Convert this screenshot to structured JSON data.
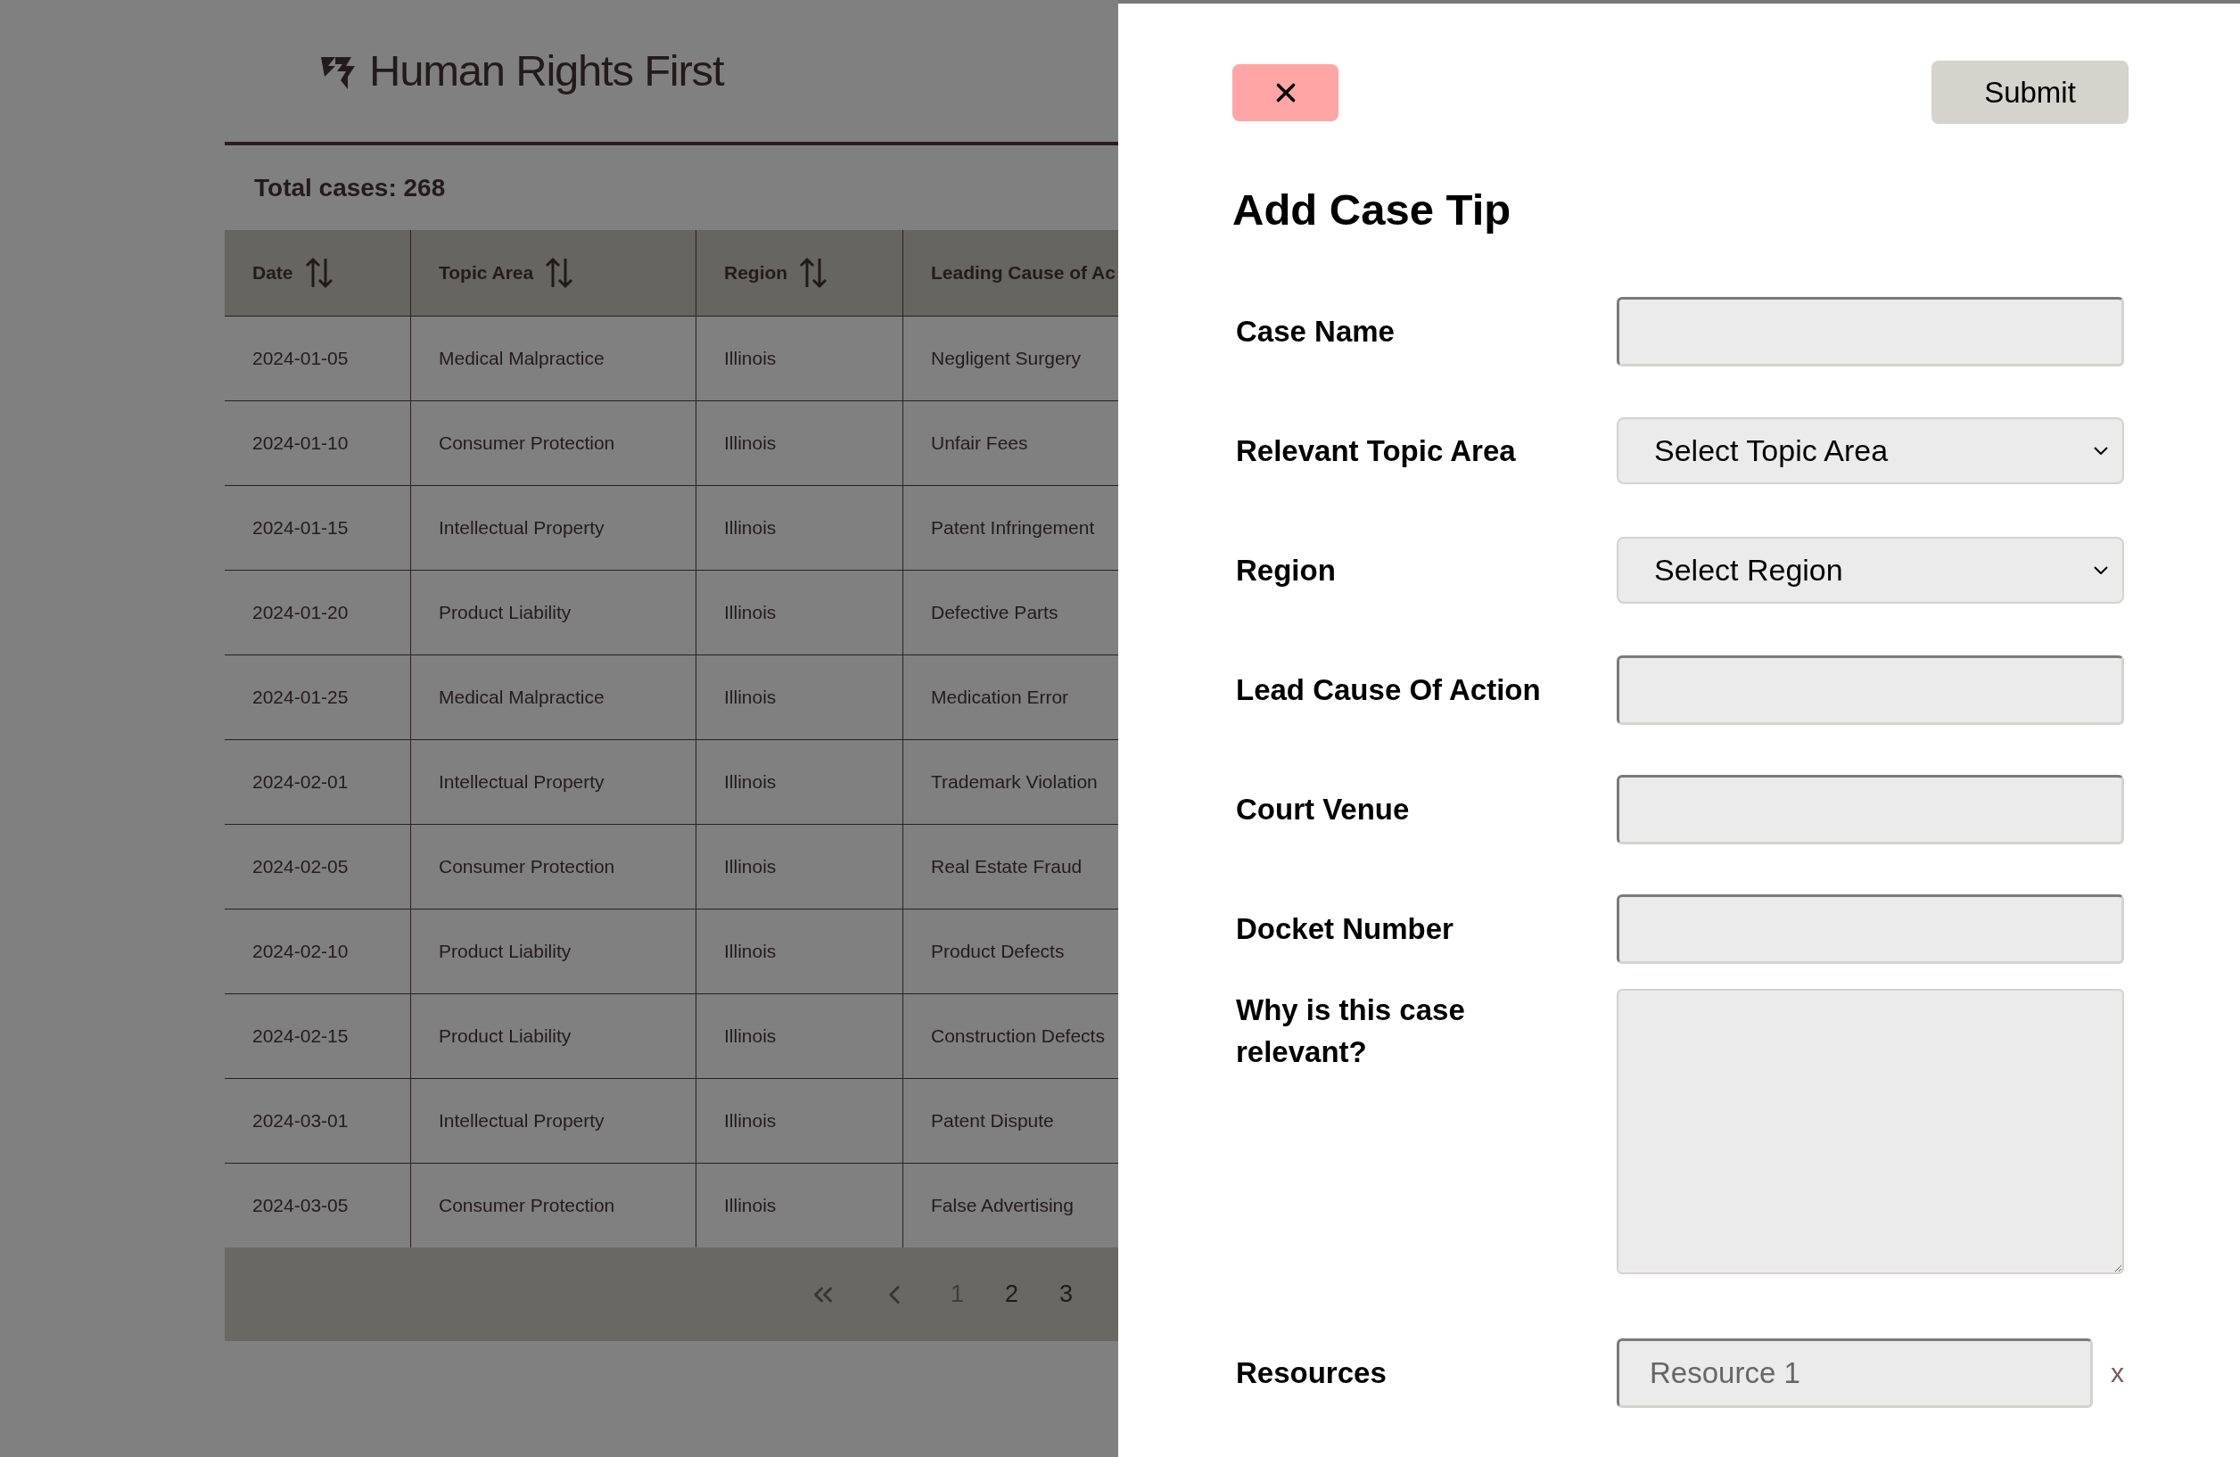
{
  "brand": {
    "name": "Human Rights First"
  },
  "total_cases": "Total cases: 268",
  "table": {
    "columns": [
      {
        "label": "Date",
        "sortable": true
      },
      {
        "label": "Topic Area",
        "sortable": true
      },
      {
        "label": "Region",
        "sortable": true
      },
      {
        "label": "Leading Cause of Ac"
      }
    ],
    "rows": [
      [
        "2024-01-05",
        "Medical Malpractice",
        "Illinois",
        "Negligent Surgery"
      ],
      [
        "2024-01-10",
        "Consumer Protection",
        "Illinois",
        "Unfair Fees"
      ],
      [
        "2024-01-15",
        "Intellectual Property",
        "Illinois",
        "Patent Infringement"
      ],
      [
        "2024-01-20",
        "Product Liability",
        "Illinois",
        "Defective Parts"
      ],
      [
        "2024-01-25",
        "Medical Malpractice",
        "Illinois",
        "Medication Error"
      ],
      [
        "2024-02-01",
        "Intellectual Property",
        "Illinois",
        "Trademark Violation"
      ],
      [
        "2024-02-05",
        "Consumer Protection",
        "Illinois",
        "Real Estate Fraud"
      ],
      [
        "2024-02-10",
        "Product Liability",
        "Illinois",
        "Product Defects"
      ],
      [
        "2024-02-15",
        "Product Liability",
        "Illinois",
        "Construction Defects"
      ],
      [
        "2024-03-01",
        "Intellectual Property",
        "Illinois",
        "Patent Dispute"
      ],
      [
        "2024-03-05",
        "Consumer Protection",
        "Illinois",
        "False Advertising"
      ]
    ]
  },
  "pagination": {
    "pages": [
      {
        "label": "1",
        "selected": true
      },
      {
        "label": "2",
        "selected": false
      },
      {
        "label": "3",
        "selected": false
      }
    ]
  },
  "drawer": {
    "submit": "Submit",
    "title": "Add Case Tip",
    "fields": [
      {
        "kind": "text",
        "label": "Case Name"
      },
      {
        "kind": "select",
        "label": "Relevant Topic Area",
        "value": "Select Topic Area"
      },
      {
        "kind": "select",
        "label": "Region",
        "value": "Select Region"
      },
      {
        "kind": "text",
        "label": "Lead Cause Of Action"
      },
      {
        "kind": "text",
        "label": "Court Venue"
      },
      {
        "kind": "text",
        "label": "Docket Number"
      },
      {
        "kind": "textarea",
        "label": "Why is this case relevant?"
      }
    ],
    "resources": {
      "label": "Resources",
      "items": [
        {
          "placeholder": "Resource 1",
          "remove": "x"
        }
      ]
    }
  }
}
